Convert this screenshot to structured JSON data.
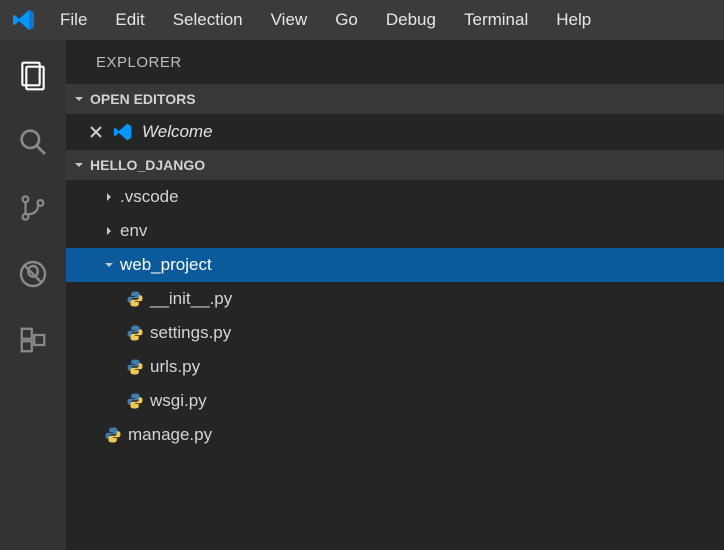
{
  "menubar": {
    "items": [
      "File",
      "Edit",
      "Selection",
      "View",
      "Go",
      "Debug",
      "Terminal",
      "Help"
    ]
  },
  "sidebar": {
    "title": "EXPLORER",
    "open_editors_header": "OPEN EDITORS",
    "open_editor_item": "Welcome",
    "project_header": "HELLO_DJANGO"
  },
  "tree": {
    "rows": [
      {
        "label": ".vscode",
        "kind": "folder",
        "expanded": false,
        "indent": 1,
        "selected": false
      },
      {
        "label": "env",
        "kind": "folder",
        "expanded": false,
        "indent": 1,
        "selected": false
      },
      {
        "label": "web_project",
        "kind": "folder",
        "expanded": true,
        "indent": 1,
        "selected": true
      },
      {
        "label": "__init__.py",
        "kind": "py",
        "expanded": false,
        "indent": 2,
        "selected": false
      },
      {
        "label": "settings.py",
        "kind": "py",
        "expanded": false,
        "indent": 2,
        "selected": false
      },
      {
        "label": "urls.py",
        "kind": "py",
        "expanded": false,
        "indent": 2,
        "selected": false
      },
      {
        "label": "wsgi.py",
        "kind": "py",
        "expanded": false,
        "indent": 2,
        "selected": false
      },
      {
        "label": "manage.py",
        "kind": "py",
        "expanded": false,
        "indent": 1,
        "selected": false
      }
    ]
  }
}
